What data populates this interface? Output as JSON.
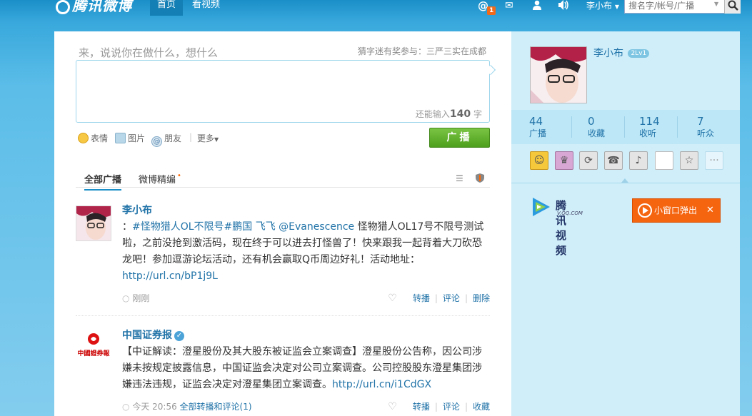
{
  "header": {
    "logo_text": "腾讯微博",
    "tabs": [
      "首页",
      "看视频"
    ],
    "notification_count": "1",
    "user_menu": "李小布",
    "search_placeholder": "搜名字/帐号/广播"
  },
  "composer": {
    "hint": "来，说说你在做什么，想什么",
    "promo": "猜字迷有奖参与：三严三实在成都",
    "counter_prefix": "还能输入",
    "counter_value": "140",
    "counter_suffix": "字",
    "tools": [
      "表情",
      "图片",
      "朋友",
      "更多"
    ],
    "post_button": "广播"
  },
  "feed_tabs": [
    "全部广播",
    "微博精编"
  ],
  "feed": [
    {
      "user": "李小布",
      "text_before": "：",
      "topics": "#怪物猎人OL不限号#鹏国 飞飞 @Evanescence",
      "text_after": " 怪物猎人OL17号不限号测试啦，之前没抢到激活码，现在终于可以进去打怪兽了！快来跟我一起背着大刀砍恐龙吧！参加逗游论坛活动，还有机会赢取Q币周边好礼！活动地址：",
      "link": "http://url.cn/bP1j9L",
      "time": "刚刚",
      "actions": [
        "转播",
        "评论",
        "删除"
      ]
    },
    {
      "user": "中国证券报",
      "logo_text": "中國證券報",
      "text": "【中证解读：澄星股份及其大股东被证监会立案调查】澄星股份公告称，因公司涉嫌未按规定披露信息，中国证监会决定对公司立案调查。公司控股股东澄星集团涉嫌违法违规，证监会决定对澄星集团立案调查。",
      "link": "http://url.cn/i1CdGX",
      "time": "今天 20:56",
      "all_comments": "全部转播和评论(1)",
      "actions": [
        "转播",
        "评论",
        "收藏"
      ]
    }
  ],
  "profile": {
    "name": "李小布",
    "level": "2Lv1",
    "stats": [
      {
        "num": "44",
        "label": "广播"
      },
      {
        "num": "0",
        "label": "收藏"
      },
      {
        "num": "114",
        "label": "收听"
      },
      {
        "num": "7",
        "label": "听众"
      }
    ],
    "app_icons": [
      "qq-pet-icon",
      "qzone-icon",
      "qplus-icon",
      "phone-icon",
      "music-icon",
      "blank-app-icon",
      "star-icon",
      "more-icon"
    ]
  },
  "sidebar": {
    "video_name": "腾讯视频",
    "video_domain": "V.QQ.COM",
    "popup_label": "小窗口弹出",
    "popup_close": "✕"
  },
  "colors": {
    "accent": "#1a8fc8",
    "link": "#2173a8",
    "post_button": "#5aae27",
    "popup": "#f5640f"
  }
}
